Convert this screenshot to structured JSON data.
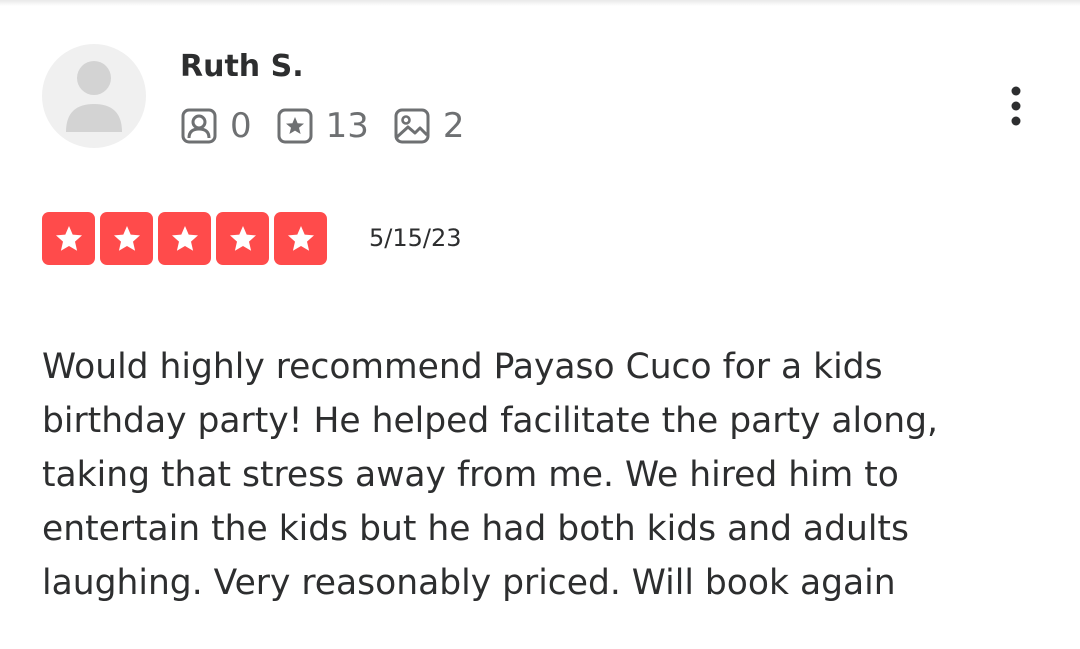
{
  "review": {
    "author": {
      "name": "Ruth S.",
      "avatar_icon": "default-avatar-icon"
    },
    "stats": {
      "friends": {
        "icon": "friends-icon",
        "value": "0"
      },
      "reviews": {
        "icon": "reviews-star-icon",
        "value": "13"
      },
      "photos": {
        "icon": "photos-icon",
        "value": "2"
      }
    },
    "menu_icon": "more-vertical-icon",
    "rating": {
      "value": 5,
      "max": 5,
      "color": "#ff4b4b"
    },
    "date": "5/15/23",
    "text": "Would highly recommend Payaso Cuco for a kids birthday party! He helped facilitate the party along, taking that stress away from me. We hired him to entertain the kids but he had both kids and adults laughing. Very reasonably priced. Will book again"
  },
  "colors": {
    "text": "#2d2e2f",
    "muted": "#6e7072",
    "star": "#ff4b4b"
  }
}
